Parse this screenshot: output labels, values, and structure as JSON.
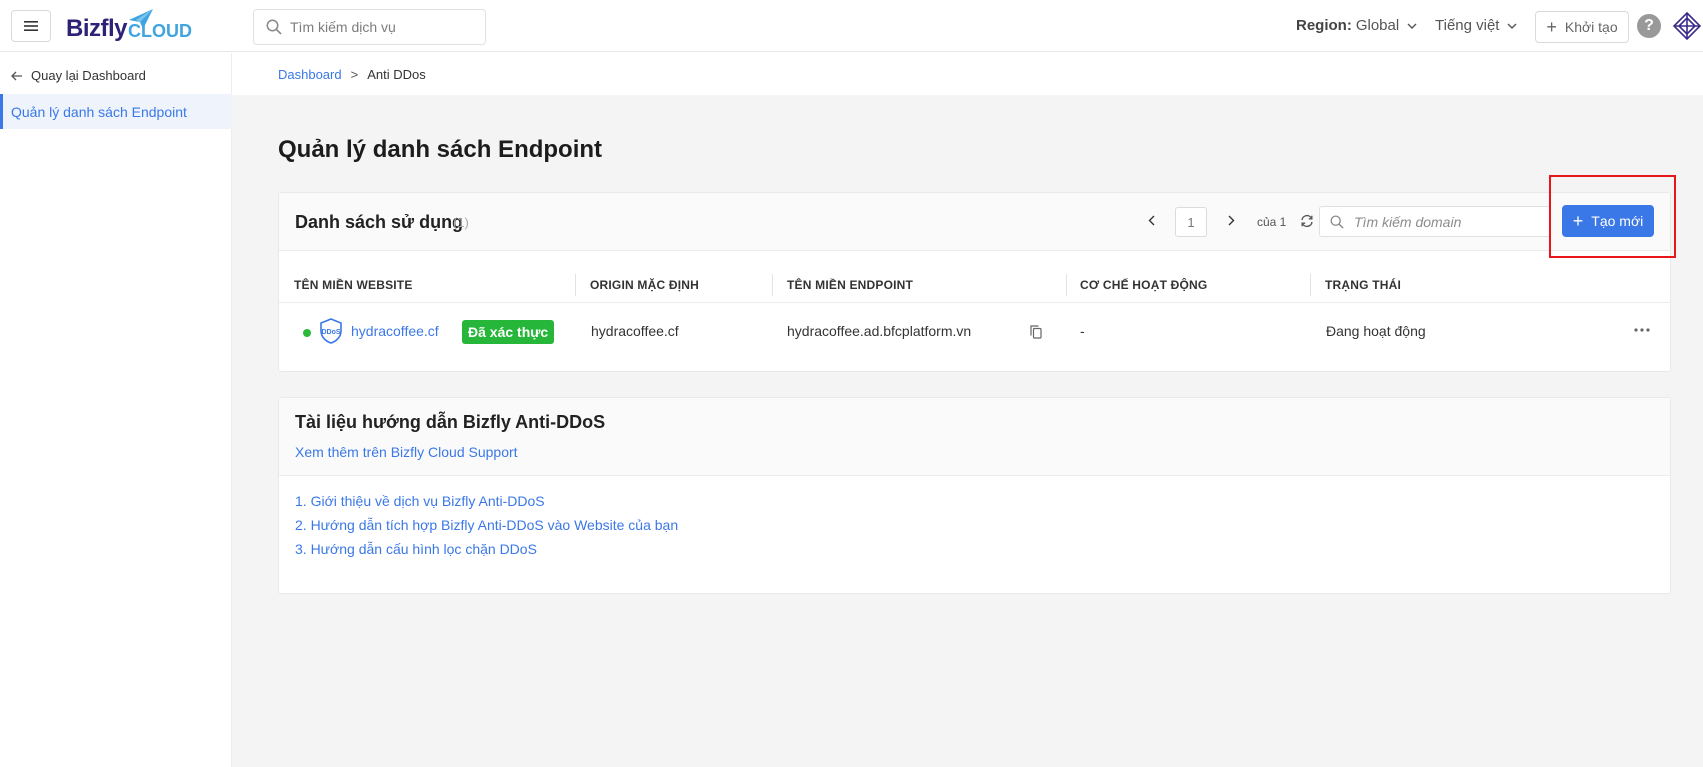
{
  "header": {
    "logo_main": "Bizfly",
    "logo_sub": "CLOUD",
    "search_placeholder": "Tìm kiếm dịch vụ",
    "region_label": "Region:",
    "region_value": "Global",
    "language": "Tiếng việt",
    "create_label": "Khởi tạo",
    "help_symbol": "?"
  },
  "sidebar": {
    "back_label": "Quay lại Dashboard",
    "items": [
      {
        "label": "Quản lý danh sách Endpoint",
        "active": true
      }
    ]
  },
  "breadcrumb": {
    "items": [
      "Dashboard",
      "Anti DDos"
    ],
    "separator": ">"
  },
  "page": {
    "title": "Quản lý danh sách Endpoint"
  },
  "list_card": {
    "title": "Danh sách sử dụng",
    "count": "(1)",
    "pager": {
      "current": "1",
      "of_label": "của 1"
    },
    "search_placeholder": "Tìm kiếm domain",
    "new_button": "Tạo mới",
    "columns": [
      "TÊN MIỀN WEBSITE",
      "ORIGIN MẶC ĐỊNH",
      "TÊN MIỀN ENDPOINT",
      "CƠ CHẾ HOẠT ĐỘNG",
      "TRẠNG THÁI"
    ],
    "rows": [
      {
        "domain": "hydracoffee.cf",
        "icon_text": "DDoS",
        "badge": "Đã xác thực",
        "origin": "hydracoffee.cf",
        "endpoint": "hydracoffee.ad.bfcplatform.vn",
        "mechanism": "-",
        "status": "Đang hoạt động",
        "status_color": "#2eb83a"
      }
    ]
  },
  "docs_card": {
    "title": "Tài liệu hướng dẫn Bizfly Anti-DDoS",
    "support_link": "Xem thêm trên Bizfly Cloud Support",
    "guides": [
      "1. Giới thiệu về dịch vụ Bizfly Anti-DDoS",
      "2. Hướng dẫn tích hợp Bizfly Anti-DDoS vào Website của bạn",
      "3. Hướng dẫn cấu hình lọc chặn DDoS"
    ]
  },
  "colors": {
    "accent": "#3b78e7",
    "success": "#26b73a",
    "highlight": "#e8161b",
    "brand_dark": "#2d2277",
    "brand_light": "#3fa4e0"
  },
  "icons": [
    "menu-icon",
    "paper-plane-icon",
    "search-icon",
    "chevron-down-icon",
    "plus-icon",
    "help-icon",
    "user-avatar-icon",
    "arrow-left-icon",
    "chevron-left-icon",
    "chevron-right-icon",
    "refresh-icon",
    "ddos-shield-icon",
    "copy-icon",
    "more-icon"
  ]
}
